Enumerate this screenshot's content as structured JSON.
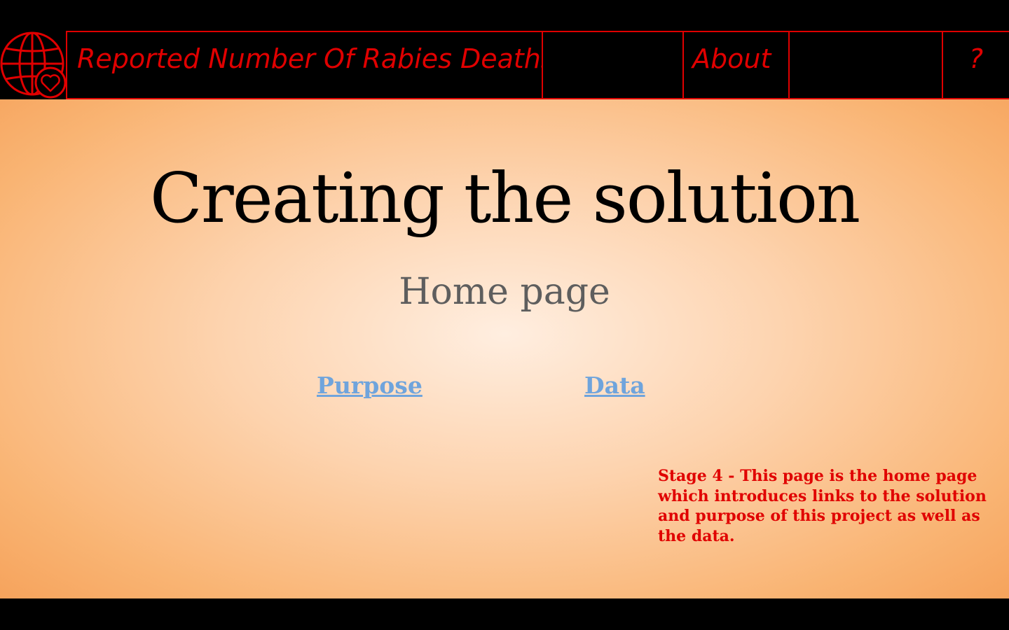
{
  "nav": {
    "logo_icon": "globe-heart-icon",
    "title": "Reported Number Of Rabies Deaths",
    "about": "About",
    "help": "?"
  },
  "main": {
    "headline": "Creating the solution",
    "subheading": "Home page",
    "links": {
      "purpose": "Purpose",
      "data": "Data"
    },
    "note": "Stage 4 - This page is the home page which introduces links to the solution and purpose of this project as well as the data."
  },
  "colors": {
    "accent": "#e00000",
    "link": "#6fa4dc",
    "bar": "#000000",
    "gradient_center": "#ffeee0",
    "gradient_edge": "#f6a35c"
  }
}
